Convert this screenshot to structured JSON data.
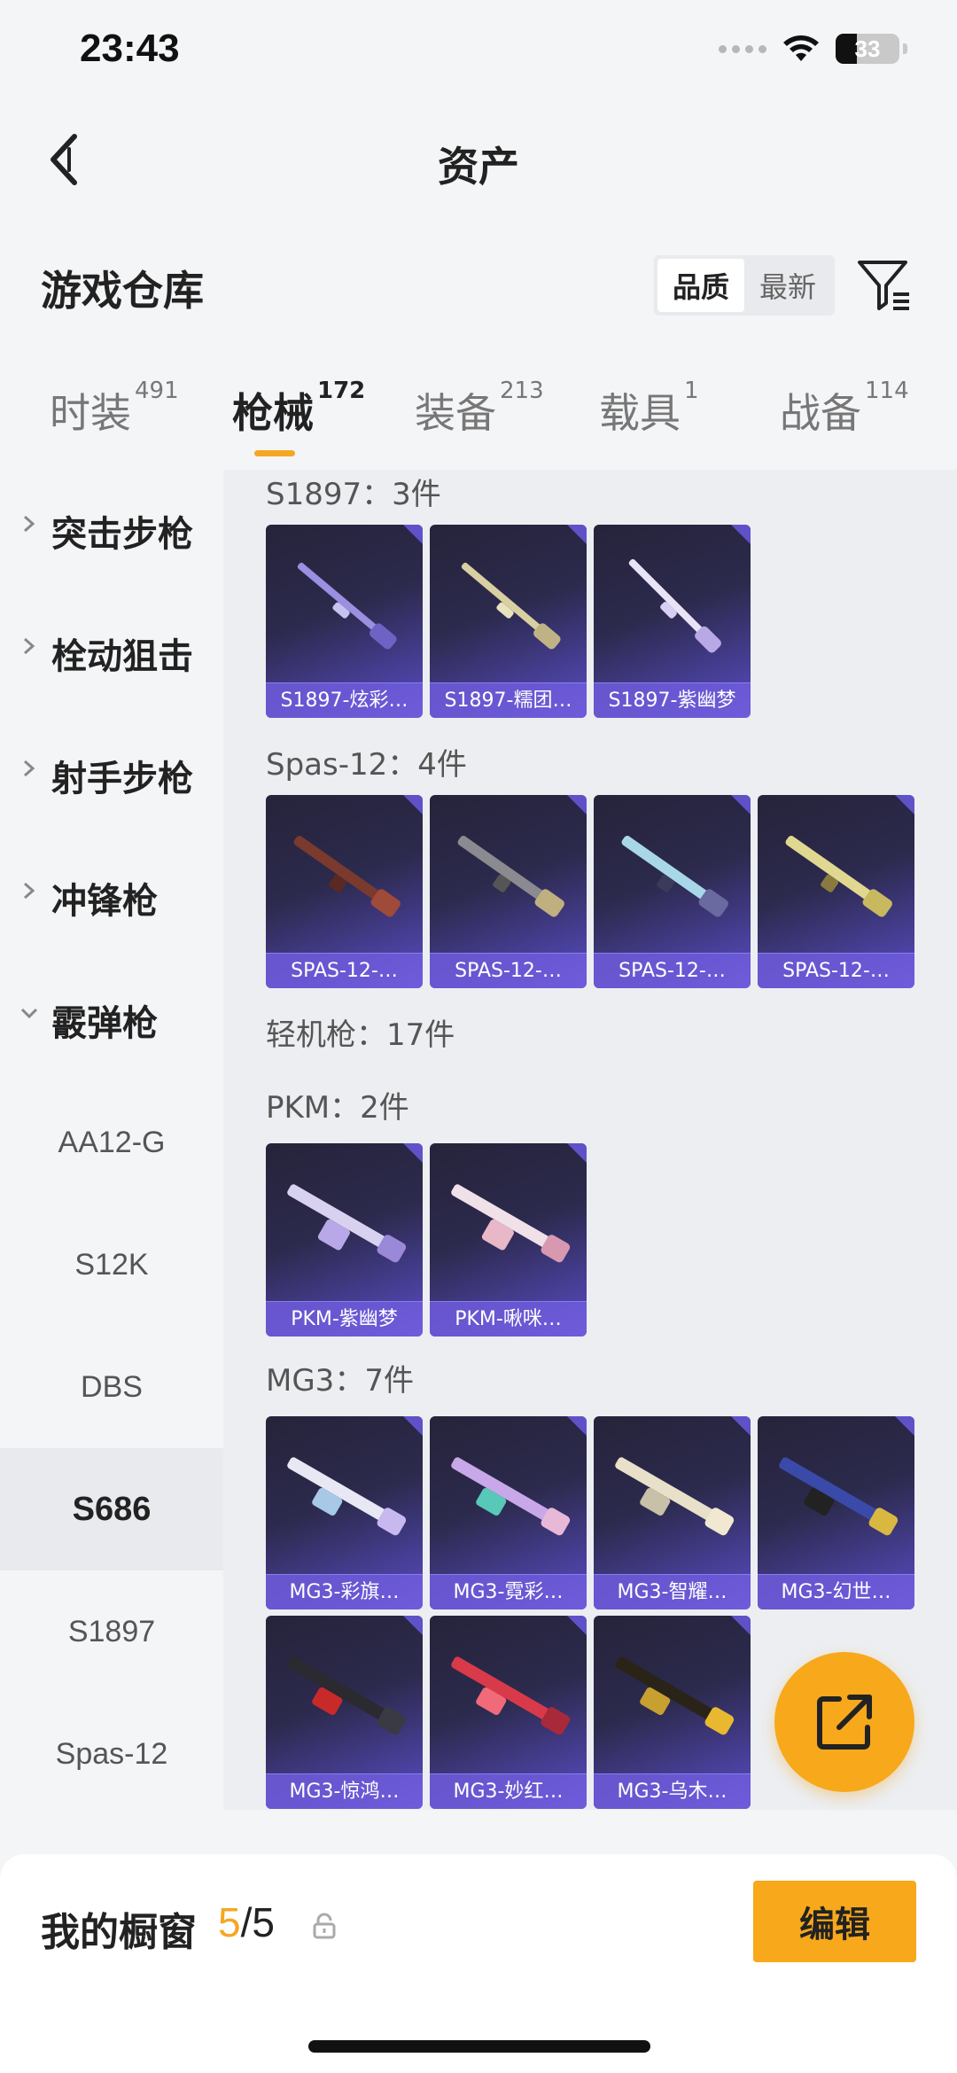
{
  "status_bar": {
    "time": "23:43",
    "battery": "33",
    "battery_level": 0.33
  },
  "header": {
    "title": "资产"
  },
  "warehouse": {
    "title": "游戏仓库",
    "sort_options": [
      "品质",
      "最新"
    ]
  },
  "tabs": [
    {
      "label": "时装",
      "count": "491"
    },
    {
      "label": "枪械",
      "count": "172"
    },
    {
      "label": "装备",
      "count": "213"
    },
    {
      "label": "载具",
      "count": "1"
    },
    {
      "label": "战备",
      "count": "114"
    }
  ],
  "sidebar": {
    "categories": [
      "突击步枪",
      "栓动狙击",
      "射手步枪",
      "冲锋枪",
      "霰弹枪"
    ],
    "subitems": [
      "AA12-G",
      "S12K",
      "DBS",
      "S686",
      "S1897",
      "Spas-12"
    ]
  },
  "content": {
    "groups": [
      {
        "title": "S1897：3件",
        "items": [
          "S1897-炫彩…",
          "S1897-糯团…",
          "S1897-紫幽梦"
        ]
      },
      {
        "title": "Spas-12：4件",
        "items": [
          "SPAS-12-…",
          "SPAS-12-…",
          "SPAS-12-…",
          "SPAS-12-…"
        ]
      },
      {
        "title": "轻机枪：17件",
        "items": []
      },
      {
        "title": "PKM：2件",
        "items": [
          "PKM-紫幽梦",
          "PKM-啾咪…"
        ]
      },
      {
        "title": "MG3：7件",
        "items": [
          "MG3-彩旗…",
          "MG3-霓彩…",
          "MG3-智耀…",
          "MG3-幻世…",
          "MG3-惊鸿…",
          "MG3-妙红…",
          "MG3-乌木…"
        ]
      }
    ]
  },
  "bottom": {
    "showcase_label": "我的橱窗",
    "current": "5",
    "total": "/5",
    "edit_label": "编辑"
  },
  "colors": {
    "accent": "#f7a81b",
    "card_purple": "#4d43a6",
    "tab_indicator": "#f5a623"
  }
}
